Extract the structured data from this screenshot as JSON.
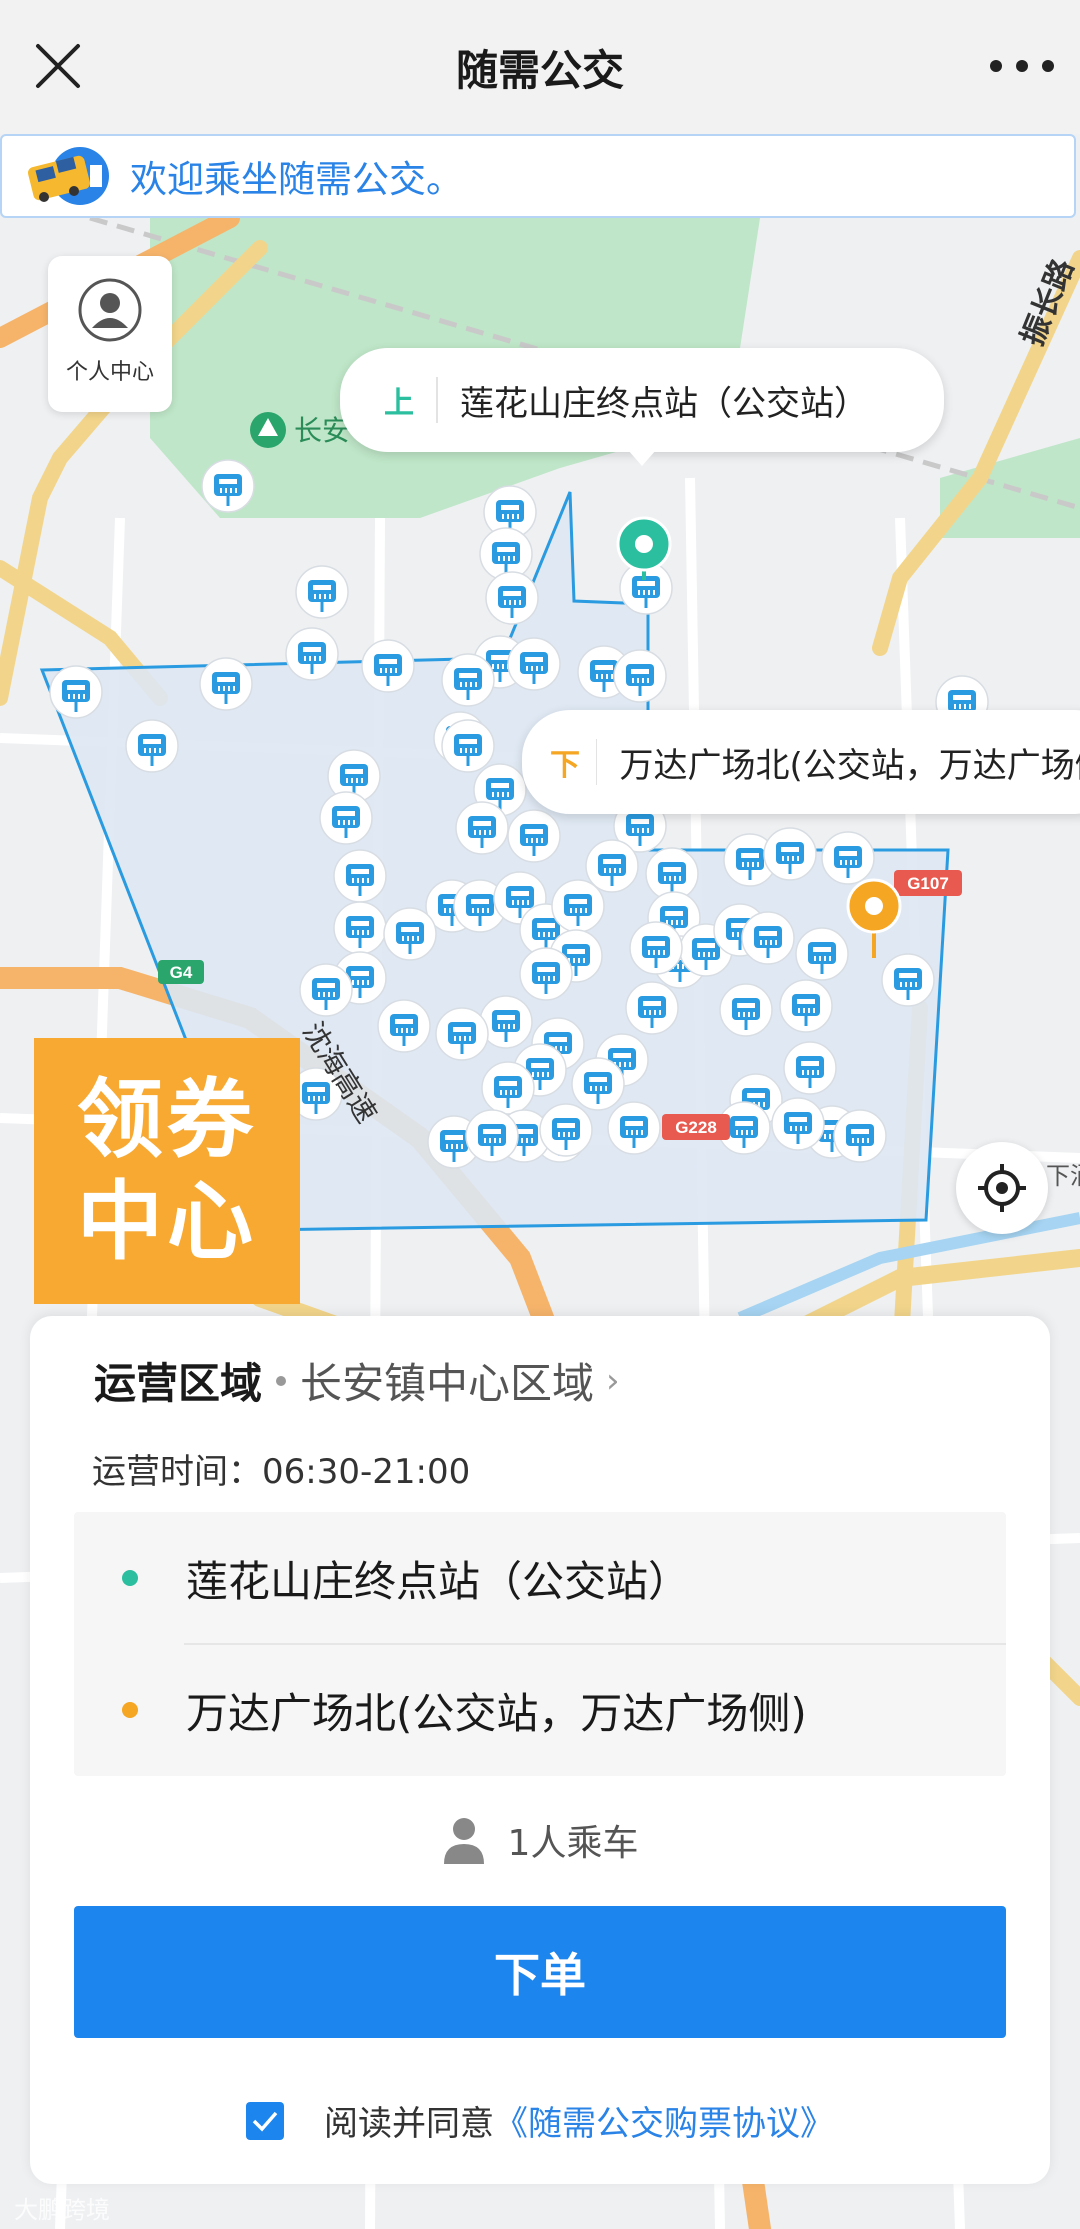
{
  "header": {
    "title": "随需公交",
    "close_icon": "close-icon",
    "more_icon": "more-dots-icon"
  },
  "notice": {
    "text": "欢迎乘坐随需公交。",
    "icon": "bus-mascot-icon"
  },
  "map": {
    "person_center_label": "个人中心",
    "pickup_bubble": {
      "tag": "上",
      "name": "莲花山庄终点站（公交站）"
    },
    "dropoff_bubble": {
      "tag": "下",
      "name": "万达广场北(公交站，万达广场侧)"
    },
    "labels": {
      "park": "长安",
      "road_vertical": "振长路",
      "highway_name": "沈海高速",
      "g4": "G4",
      "g107": "G107",
      "g228": "G228",
      "edge_place": "下涌"
    },
    "coupon": {
      "line1": "领券",
      "line2": "中心"
    },
    "locate_icon": "locate-target-icon",
    "colors": {
      "zone_fill": "#dde7f3",
      "zone_stroke": "#2a9be0",
      "pickup": "#2cbf9f",
      "dropoff": "#f5a623"
    }
  },
  "card": {
    "area_label": "运营区域",
    "area_value": "长安镇中心区域",
    "hours": "运营时间：06:30-21:00",
    "stops": [
      {
        "name": "莲花山庄终点站（公交站）",
        "color": "#2cbf9f"
      },
      {
        "name": "万达广场北(公交站，万达广场侧)",
        "color": "#f5a623"
      }
    ],
    "passengers": "1人乘车",
    "order_button": "下单",
    "agree_text": "阅读并同意",
    "agree_link": "《随需公交购票协议》",
    "agree_checked": true
  },
  "watermark": "大鹏跨境",
  "accent_color": "#1c86ee"
}
